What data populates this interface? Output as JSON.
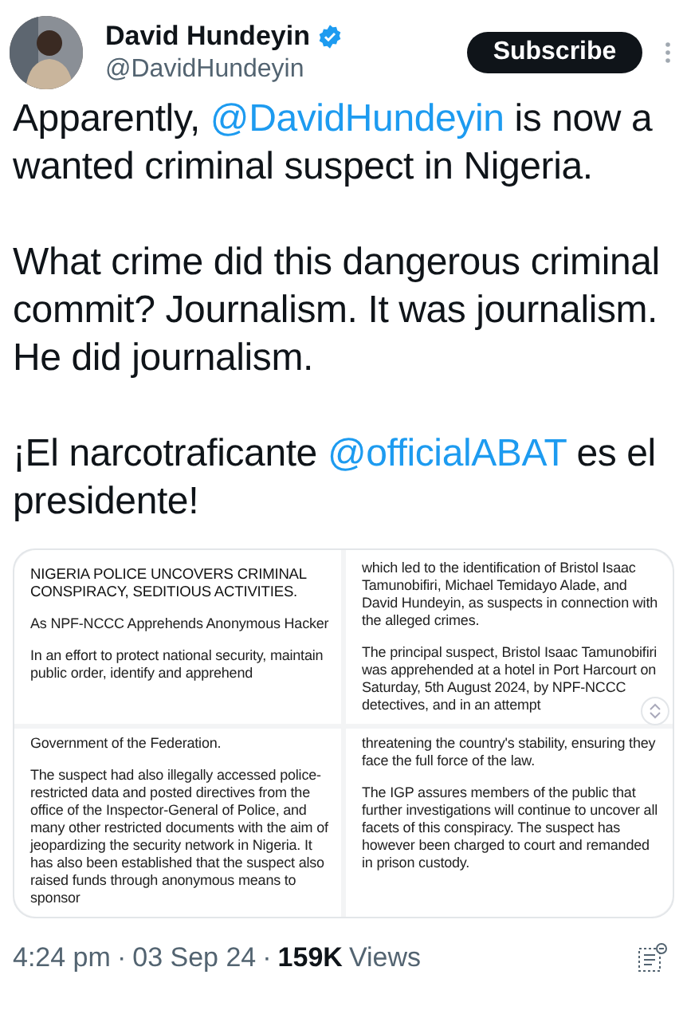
{
  "author": {
    "name": "David Hundeyin",
    "handle": "@DavidHundeyin",
    "verified": true
  },
  "subscribe_button": "Subscribe",
  "paragraphs": [
    [
      {
        "kind": "text",
        "text": "Apparently, "
      },
      {
        "kind": "mention",
        "text": "@DavidHundeyin"
      },
      {
        "kind": "text",
        "text": " is now a wanted criminal suspect in Nigeria."
      }
    ],
    [
      {
        "kind": "text",
        "text": "What crime did this dangerous criminal commit? Journalism. It was journalism. He did journalism."
      }
    ],
    [
      {
        "kind": "text",
        "text": "¡El narcotraficante "
      },
      {
        "kind": "mention",
        "text": "@officialABAT"
      },
      {
        "kind": "text",
        "text": " es el presidente!"
      }
    ]
  ],
  "document_panels": [
    {
      "blocks": [
        {
          "kind": "heading",
          "text": "NIGERIA POLICE UNCOVERS CRIMINAL CONSPIRACY, SEDITIOUS ACTIVITIES."
        },
        {
          "kind": "body",
          "text": "As NPF-NCCC Apprehends Anonymous Hacker"
        },
        {
          "kind": "body",
          "text": "In an effort to protect national security, maintain public order, identify and apprehend"
        }
      ]
    },
    {
      "blocks": [
        {
          "kind": "body",
          "text": "which led to the identification of Bristol Isaac Tamunobifiri, Michael Temidayo Alade, and David Hundeyin, as suspects in connection with the alleged crimes."
        },
        {
          "kind": "body",
          "text": "The principal suspect, Bristol Isaac Tamunobifiri was apprehended at a hotel in Port Harcourt on Saturday, 5th August 2024, by NPF-NCCC detectives, and in an attempt"
        }
      ]
    },
    {
      "blocks": [
        {
          "kind": "body",
          "text": "Government of the Federation."
        },
        {
          "kind": "body",
          "text": "The suspect had also illegally accessed police-restricted data and posted directives from the office of the Inspector-General of Police, and many other restricted documents with the aim of jeopardizing the security network in Nigeria. It has also been established that the suspect also raised funds through anonymous means to sponsor"
        }
      ]
    },
    {
      "blocks": [
        {
          "kind": "body",
          "text": "threatening the country's stability, ensuring they face the full force of the law."
        },
        {
          "kind": "body",
          "text": "The IGP assures members of the public that further investigations will continue to uncover all facets of this conspiracy. The suspect has however been charged to court and remanded in prison custody."
        }
      ]
    }
  ],
  "meta": {
    "time": "4:24 pm",
    "separator": "·",
    "date": "03 Sep 24",
    "views_count": "159K",
    "views_label": "Views"
  }
}
